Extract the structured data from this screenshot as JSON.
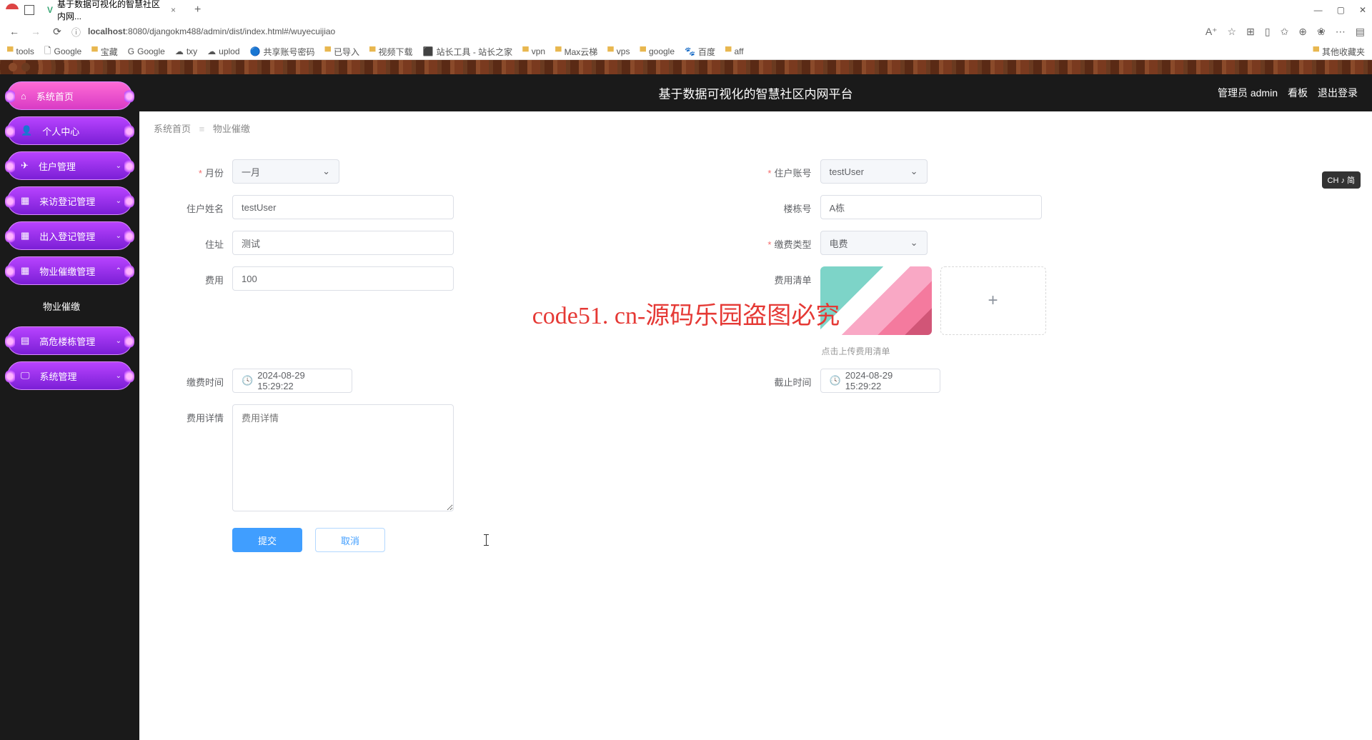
{
  "browser": {
    "tab_title": "基于数据可视化的智慧社区内网...",
    "url_host": "localhost",
    "url_path": ":8080/djangokm488/admin/dist/index.html#/wuyecuijiao",
    "bookmarks": [
      "tools",
      "Google",
      "宝藏",
      "Google",
      "txy",
      "uplod",
      "共享账号密码",
      "已导入",
      "视频下载",
      "站长工具 - 站长之家",
      "vpn",
      "Max云梯",
      "vps",
      "google",
      "百度",
      "aff"
    ],
    "bookmark_overflow": "其他收藏夹"
  },
  "header": {
    "title": "基于数据可视化的智慧社区内网平台",
    "user_label": "管理员 admin",
    "kanban": "看板",
    "logout": "退出登录"
  },
  "sidebar": {
    "items": [
      {
        "icon": "home",
        "label": "系统首页"
      },
      {
        "icon": "user",
        "label": "个人中心"
      },
      {
        "icon": "plane",
        "label": "住户管理"
      },
      {
        "icon": "grid",
        "label": "来访登记管理"
      },
      {
        "icon": "grid",
        "label": "出入登记管理"
      },
      {
        "icon": "grid",
        "label": "物业催缴管理",
        "expanded": true
      },
      {
        "icon": "list",
        "label": "高危楼栋管理"
      },
      {
        "icon": "monitor",
        "label": "系统管理"
      }
    ],
    "sub": "物业催缴"
  },
  "breadcrumb": {
    "root": "系统首页",
    "current": "物业催缴"
  },
  "form": {
    "month": {
      "label": "月份",
      "value": "一月"
    },
    "account": {
      "label": "住户账号",
      "value": "testUser"
    },
    "name": {
      "label": "住户姓名",
      "value": "testUser"
    },
    "building": {
      "label": "楼栋号",
      "value": "A栋"
    },
    "address": {
      "label": "住址",
      "value": "测试"
    },
    "feeType": {
      "label": "缴费类型",
      "value": "电费"
    },
    "fee": {
      "label": "费用",
      "value": "100"
    },
    "feeList": {
      "label": "费用清单",
      "hint": "点击上传费用清单"
    },
    "payTime": {
      "label": "缴费时间",
      "value": "2024-08-29 15:29:22"
    },
    "deadline": {
      "label": "截止时间",
      "value": "2024-08-29 15:29:22"
    },
    "detail": {
      "label": "费用详情",
      "placeholder": "费用详情"
    },
    "submit": "提交",
    "cancel": "取消"
  },
  "watermark": "code51.cn",
  "big_watermark": "code51. cn-源码乐园盗图必究",
  "ime": "CH ♪ 简"
}
